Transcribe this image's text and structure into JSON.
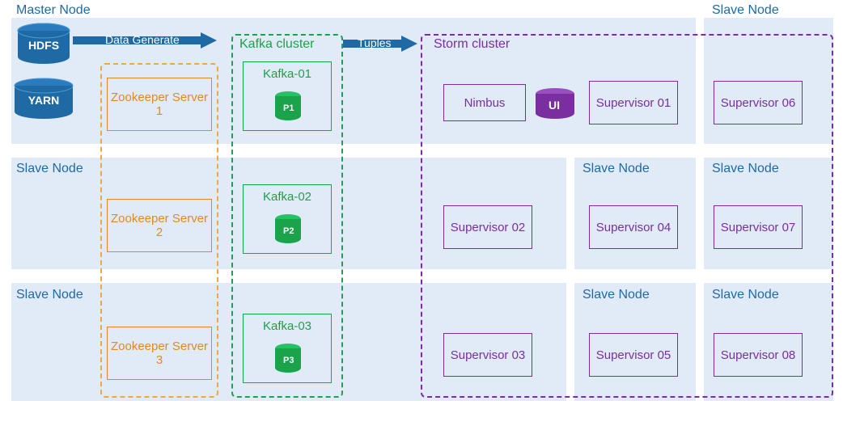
{
  "labels": {
    "master": "Master Node",
    "slave": "Slave Node",
    "hdfs": "HDFS",
    "yarn": "YARN",
    "kafka_cluster": "Kafka cluster",
    "storm_cluster": "Storm cluster",
    "data_generate": "Data Generate",
    "tuples": "Tuples",
    "nimbus": "Nimbus",
    "ui": "UI"
  },
  "zookeeper": [
    {
      "name": "Zookeeper Server 1"
    },
    {
      "name": "Zookeeper Server 2"
    },
    {
      "name": "Zookeeper Server 3"
    }
  ],
  "kafka": [
    {
      "name": "Kafka-01",
      "partition": "P1"
    },
    {
      "name": "Kafka-02",
      "partition": "P2"
    },
    {
      "name": "Kafka-03",
      "partition": "P3"
    }
  ],
  "supervisors": {
    "s01": "Supervisor 01",
    "s02": "Supervisor 02",
    "s03": "Supervisor 03",
    "s04": "Supervisor 04",
    "s05": "Supervisor 05",
    "s06": "Supervisor 06",
    "s07": "Supervisor 07",
    "s08": "Supervisor 08"
  },
  "colors": {
    "blue": "#1f6aa5",
    "orange": "#e08a1e",
    "green": "#1aa34a",
    "purple": "#7a2ea0",
    "pale": "#e1ebf7"
  }
}
